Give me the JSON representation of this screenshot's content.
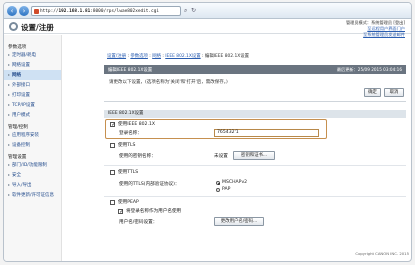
{
  "browser": {
    "url_prefix": "http://",
    "url_host": "192.168.1.81",
    "url_rest": ":8000/rps/lwae802xedit.cgi"
  },
  "header": {
    "title": "设置/注册",
    "user_line1": "管理员模式：系统管理员 [登出]",
    "link_portal": "至远程用户界面门户",
    "link_mail": "至系统管理员发送邮件"
  },
  "sidebar": {
    "sections": [
      {
        "label": "参数选项",
        "items": [
          "定时器/耗电",
          "网络设置",
          "网络",
          "外部接口",
          "打印设置",
          "TCP/IP设置",
          "用户模式"
        ]
      },
      {
        "label": "管理/控制",
        "items": [
          "应用程序安装",
          "设备控制"
        ]
      },
      {
        "label": "管理设置",
        "items": [
          "部门/ID/功能限制",
          "安全",
          "导入/导出",
          "软件更新/许可证信息"
        ]
      }
    ],
    "active": "网络设置"
  },
  "breadcrumb": {
    "parts": [
      "设置/注册",
      "参数选项",
      "网络",
      "IEEE 802.1X设置"
    ],
    "current": "编辑IEEE 802.1X设置"
  },
  "panel": {
    "title": "编辑IEEE 802.1X设置",
    "timestamp": "最后更新：25/09 2015 03:04:16",
    "description": "请更改以下设置，(选项名称为'关闭'和'打开'后，需改保存。)",
    "ok_label": "确定",
    "cancel_label": "取消"
  },
  "form": {
    "section_label": "IEEE 802.1X设置",
    "use_ieee_label": "使用IEEE 802.1X",
    "use_ieee_checked": true,
    "login_name_label": "登录名称：",
    "login_name_value": "765432'1",
    "tls_label": "使用TLS",
    "tls_checked": false,
    "key_cert_label": "使用的密钥名称：",
    "key_cert_status": "未设置",
    "key_cert_btn": "密钥和证书...",
    "ttls_label": "使用TTLS",
    "ttls_checked": false,
    "ttls_inner_label": "使用的TTLS(内部验证协议)：",
    "ttls_option1": "MSCHAPv2",
    "ttls_option2": "PAP",
    "ttls_selected": "MSCHAPv2",
    "peap_label": "使用PEAP",
    "peap_checked": false,
    "peap_sub_label": "将登录名称作为用户名使用",
    "peap_sub_checked": true,
    "userpass_label": "用户名/密码设置：",
    "userpass_btn": "更改用户名/密码..."
  },
  "footer": {
    "copyright": "Copyright CANON INC. 2015"
  }
}
